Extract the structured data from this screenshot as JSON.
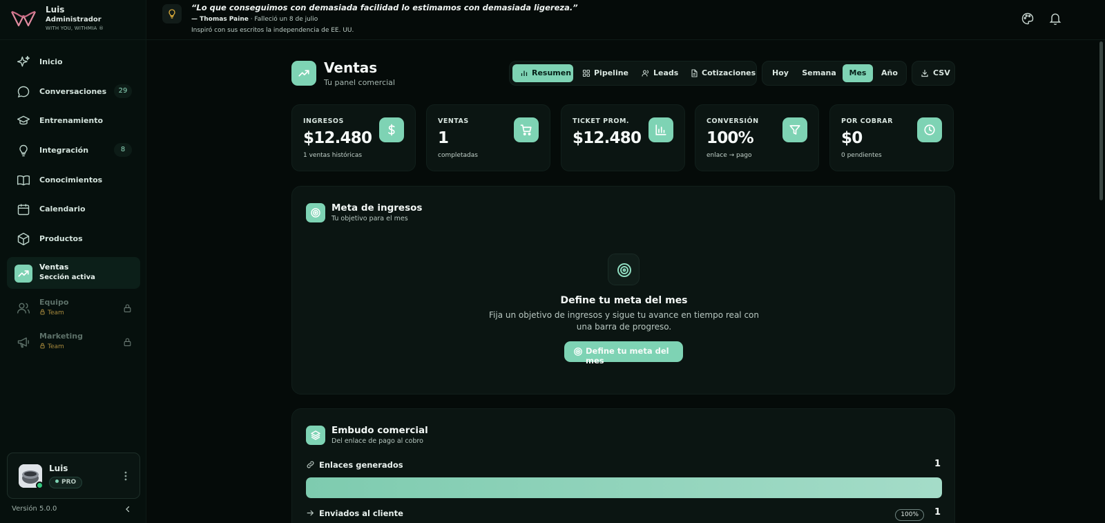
{
  "user": {
    "name": "Luis",
    "role": "Administrador",
    "tagline": "WITH YOU, WITHMIA ®"
  },
  "quote": {
    "text": "“Lo que conseguimos con demasiada facilidad lo estimamos con demasiada ligereza.”",
    "author": "— Thomas Paine",
    "author_note": " · Falleció un 8 de julio",
    "note": "Inspiró con sus escritos la independencia de EE. UU."
  },
  "sidebar": {
    "items": [
      {
        "label": "Inicio",
        "icon": "sparkles-icon"
      },
      {
        "label": "Conversaciones",
        "icon": "chat-bubble-icon",
        "badge": "29"
      },
      {
        "label": "Entrenamiento",
        "icon": "graduation-cap-icon"
      },
      {
        "label": "Integración",
        "icon": "lightbulb-icon",
        "badge": "8"
      },
      {
        "label": "Conocimientos",
        "icon": "book-icon"
      },
      {
        "label": "Calendario",
        "icon": "calendar-icon"
      },
      {
        "label": "Productos",
        "icon": "box-icon"
      },
      {
        "label": "Ventas",
        "icon": "trending-up-icon",
        "sub": "Sección activa",
        "active": true
      },
      {
        "label": "Equipo",
        "icon": "users-icon",
        "sub": "Team",
        "locked": true
      },
      {
        "label": "Marketing",
        "icon": "megaphone-icon",
        "sub": "Team",
        "locked": true
      }
    ]
  },
  "profile": {
    "name": "Luis",
    "plan": "PRO"
  },
  "version": "Versión 5.0.0",
  "page": {
    "title": "Ventas",
    "subtitle": "Tu panel comercial"
  },
  "tabs": [
    "Resumen",
    "Pipeline",
    "Leads",
    "Cotizaciones"
  ],
  "active_tab": "Resumen",
  "periods": [
    "Hoy",
    "Semana",
    "Mes",
    "Año"
  ],
  "active_period": "Mes",
  "export_label": "CSV",
  "kpis": [
    {
      "label": "INGRESOS",
      "value": "$12.480",
      "sub": "1 ventas históricas",
      "icon": "dollar-icon"
    },
    {
      "label": "VENTAS",
      "value": "1",
      "sub": "completadas",
      "icon": "cart-icon"
    },
    {
      "label": "TICKET PROM.",
      "value": "$12.480",
      "sub": "",
      "icon": "bar-chart-icon"
    },
    {
      "label": "CONVERSIÓN",
      "value": "100%",
      "sub": "enlace → pago",
      "icon": "funnel-icon"
    },
    {
      "label": "POR COBRAR",
      "value": "$0",
      "sub": "0 pendientes",
      "icon": "clock-icon"
    }
  ],
  "goal": {
    "title": "Meta de ingresos",
    "subtitle": "Tu objetivo para el mes",
    "empty_title": "Define tu meta del mes",
    "empty_desc": "Fija un objetivo de ingresos y sigue tu avance en tiempo real con una barra de progreso.",
    "button": "Define tu meta del mes"
  },
  "funnel": {
    "title": "Embudo comercial",
    "subtitle": "Del enlace de pago al cobro",
    "rows": [
      {
        "label": "Enlaces generados",
        "value": "1",
        "fill": 1.0,
        "icon": "link-icon"
      },
      {
        "label": "Enviados al cliente",
        "value": "1",
        "pct": "100%",
        "icon": "arrow-right-icon"
      }
    ]
  },
  "colors": {
    "accent": "#7ed3b4",
    "background": "#050b09",
    "card": "#0b1512"
  }
}
